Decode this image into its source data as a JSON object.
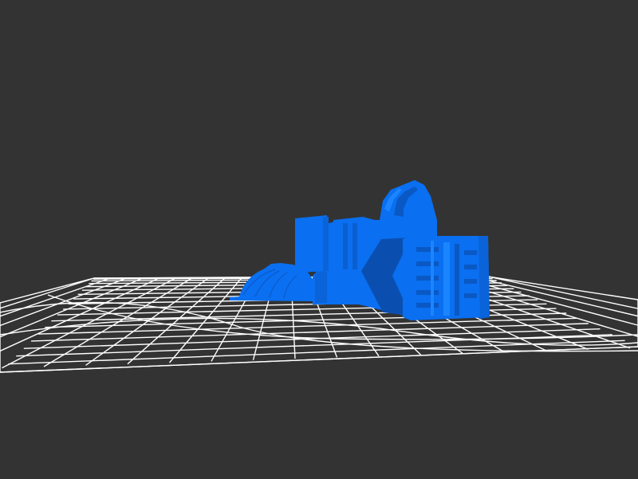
{
  "scene": {
    "kind": "3d-model-viewer",
    "background_color": "#333333",
    "grid_color": "#ffffff",
    "model_color": "#0a6ff0",
    "model_shadow_color": "#0a4fb0",
    "model_highlight_color": "#1a85ff",
    "objects": [
      {
        "name": "ground-grid",
        "type": "wireframe-plane"
      },
      {
        "name": "machine-model",
        "type": "solid-mesh"
      }
    ]
  }
}
